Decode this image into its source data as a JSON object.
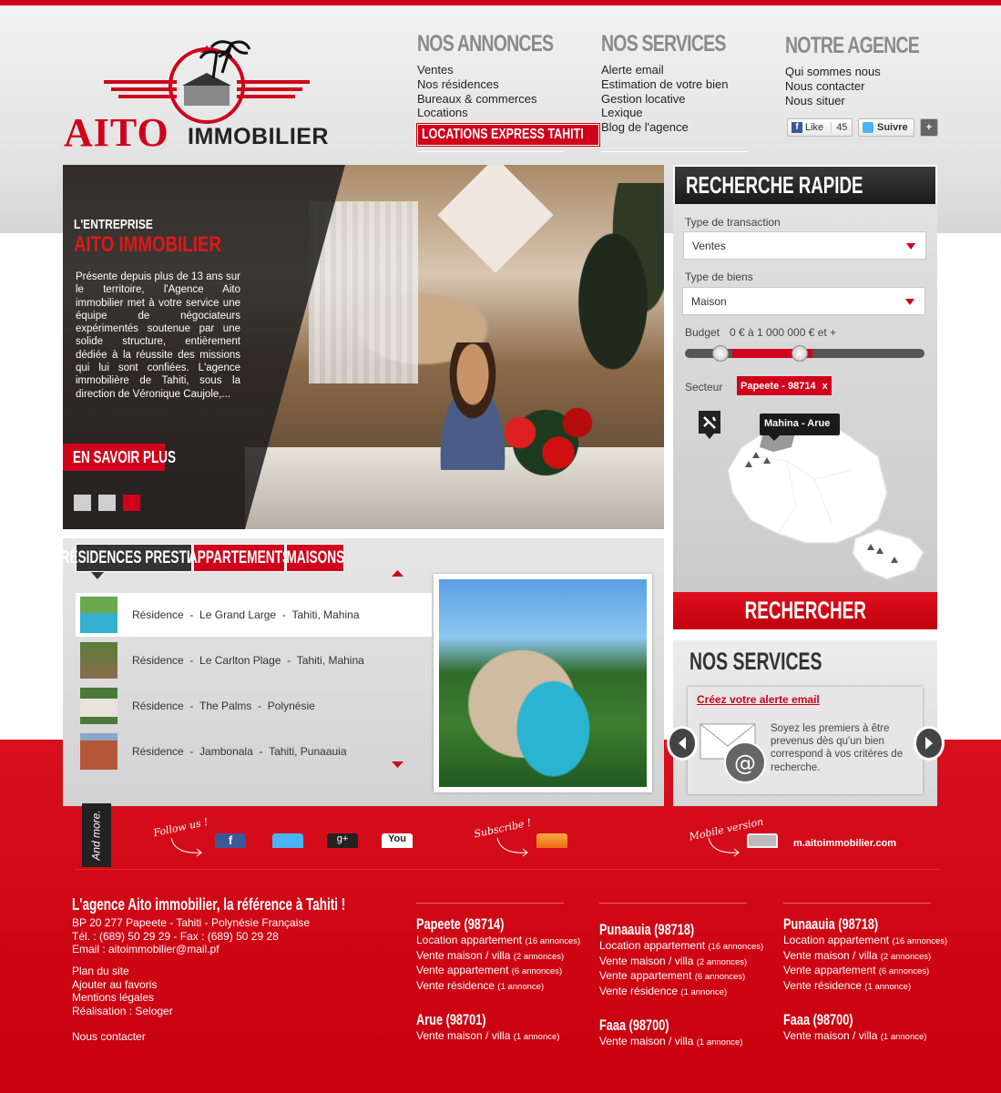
{
  "header": {
    "logo": {
      "brand": "AITO",
      "tagline": "IMMOBILIER"
    },
    "nav": [
      {
        "title": "NOS ANNONCES",
        "items": [
          "Ventes",
          "Nos résidences",
          "Bureaux & commerces",
          "Locations"
        ],
        "cta": "LOCATIONS EXPRESS TAHITI"
      },
      {
        "title": "NOS SERVICES",
        "items": [
          "Alerte email",
          "Estimation de votre bien",
          "Gestion locative",
          "Lexique",
          "Blog de l'agence"
        ]
      },
      {
        "title": "NOTRE AGENCE",
        "items": [
          "Qui sommes nous",
          "Nous contacter",
          "Nous situer"
        ]
      }
    ],
    "social": {
      "like": "Like",
      "like_count": "45",
      "follow": "Suivre",
      "plus": "+"
    }
  },
  "hero": {
    "subtitle": "L'ENTREPRISE",
    "title": "AITO IMMOBILIER",
    "text": "Présente depuis plus de 13 ans sur le territoire, l'Agence Aito immobilier met à votre service une équipe de négociateurs expérimentés soutenue par une solide structure, entièrement dédiée à la réussite des missions qui lui sont confiées. L'agence immobilière de Tahiti, sous la direction de Véronique Caujole,...",
    "button": "EN SAVOIR PLUS",
    "slides": 3,
    "active_slide": 3
  },
  "residences": {
    "tabs": [
      "RÉSIDENCES PRESTIGE",
      "APPARTEMENTS",
      "MAISONS"
    ],
    "rows": [
      {
        "type": "Résidence",
        "name": "Le Grand Large",
        "location": "Tahiti, Mahina"
      },
      {
        "type": "Résidence",
        "name": "Le Carlton Plage",
        "location": "Tahiti, Mahina"
      },
      {
        "type": "Résidence",
        "name": "The Palms",
        "location": "Polynésie"
      },
      {
        "type": "Résidence",
        "name": "Jambonala",
        "location": "Tahiti, Punaauia"
      }
    ],
    "separator": "-"
  },
  "search": {
    "title": "RECHERCHE RAPIDE",
    "transaction_label": "Type de transaction",
    "transaction_value": "Ventes",
    "property_label": "Type de biens",
    "property_value": "Maison",
    "budget_label": "Budget",
    "budget_value": "0 € à 1 000 000 € et +",
    "sector_label": "Secteur",
    "sector_tag": "Papeete - 98714",
    "sector_remove": "x",
    "map_tooltip": "Mahina - Arue",
    "button": "RECHERCHER"
  },
  "services": {
    "title": "NOS SERVICES",
    "link": "Créez votre alerte email",
    "text": "Soyez les premiers à être prevenus dès qu'un bien correspond à vos critères de recherche."
  },
  "follow": {
    "andmore": "And more.",
    "follow_us": "Follow us !",
    "subscribe": "Subscribe !",
    "mobile": "Mobile version",
    "mobile_url": "m.aitoimmobilier.com",
    "icons": [
      "facebook-icon",
      "twitter-icon",
      "googleplus-icon",
      "youtube-icon",
      "rss-icon",
      "mobile-icon"
    ],
    "gplus_label": "g+",
    "youtube_label": "You"
  },
  "footer": {
    "title": "L'agence Aito immobilier, la référence à Tahiti !",
    "address": [
      "BP 20 277 Papeete - Tahiti - Polynésie Française",
      "Tél. : (689) 50 29 29 - Fax : (689) 50 29 28",
      "Email : aitoimmobilier@mail.pf"
    ],
    "links": [
      "Plan du site",
      "Ajouter au favoris",
      "Mentions légales",
      "Réalisation : Seloger"
    ],
    "contact": "Nous contacter",
    "columns": [
      {
        "blocks": [
          {
            "city": "Papeete (98714)",
            "lines": [
              [
                "Location appartement",
                "(16 annonces)"
              ],
              [
                "Vente maison / villa",
                "(2 annonces)"
              ],
              [
                "Vente appartement",
                "(6 annonces)"
              ],
              [
                "Vente résidence",
                "(1 annonce)"
              ]
            ]
          },
          {
            "city": "Arue (98701)",
            "lines": [
              [
                "Vente maison / villa",
                "(1 annonce)"
              ]
            ]
          }
        ]
      },
      {
        "blocks": [
          {
            "city": "Punaauia (98718)",
            "lines": [
              [
                "Location appartement",
                "(16 annonces)"
              ],
              [
                "Vente maison / villa",
                "(2 annonces)"
              ],
              [
                "Vente appartement",
                "(6 annonces)"
              ],
              [
                "Vente résidence",
                "(1 annonce)"
              ]
            ]
          },
          {
            "city": "Faaa (98700)",
            "lines": [
              [
                "Vente maison / villa",
                "(1 annonce)"
              ]
            ]
          }
        ]
      },
      {
        "blocks": [
          {
            "city": "Punaauia (98718)",
            "lines": [
              [
                "Location appartement",
                "(16 annonces)"
              ],
              [
                "Vente maison / villa",
                "(2 annonces)"
              ],
              [
                "Vente appartement",
                "(6 annonces)"
              ],
              [
                "Vente résidence",
                "(1 annonce)"
              ]
            ]
          },
          {
            "city": "Faaa (98700)",
            "lines": [
              [
                "Vente maison / villa",
                "(1 annonce)"
              ]
            ]
          }
        ]
      }
    ]
  },
  "colors": {
    "brand_red": "#d0021b",
    "dark": "#222222"
  }
}
